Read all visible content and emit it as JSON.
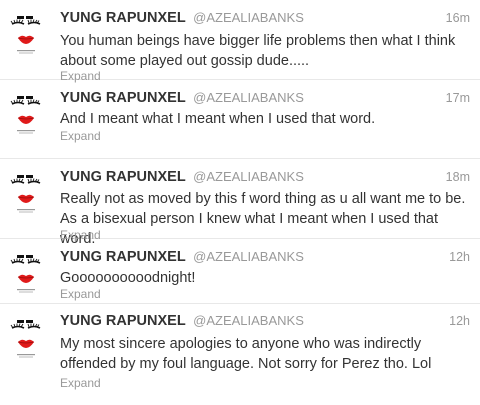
{
  "tweets": [
    {
      "fullname": "YUNG RAPUNXEL",
      "username": "@AZEALIABANKS",
      "time": "16m",
      "text": "You human beings have bigger life problems then what I think about some played out gossip dude.....",
      "expand": "Expand"
    },
    {
      "fullname": "YUNG RAPUNXEL",
      "username": "@AZEALIABANKS",
      "time": "17m",
      "text": "And I meant what I meant when I used that word.",
      "expand": "Expand"
    },
    {
      "fullname": "YUNG RAPUNXEL",
      "username": "@AZEALIABANKS",
      "time": "18m",
      "text": "Really not as moved by this f word thing as u all want me to be. As a bisexual person I knew what I meant when I used that word.",
      "expand": "Expand"
    },
    {
      "fullname": "YUNG RAPUNXEL",
      "username": "@AZEALIABANKS",
      "time": "12h",
      "text": "Goooooooooodnight!",
      "expand": "Expand"
    },
    {
      "fullname": "YUNG RAPUNXEL",
      "username": "@AZEALIABANKS",
      "time": "12h",
      "text": "My most sincere apologies to anyone who was indirectly offended by my foul language. Not sorry for Perez tho. Lol",
      "expand": "Expand"
    }
  ],
  "avatar": {
    "icon": "lips-and-lashes-avatar",
    "lip_color": "#e01a1a",
    "lash_color": "#111111"
  }
}
